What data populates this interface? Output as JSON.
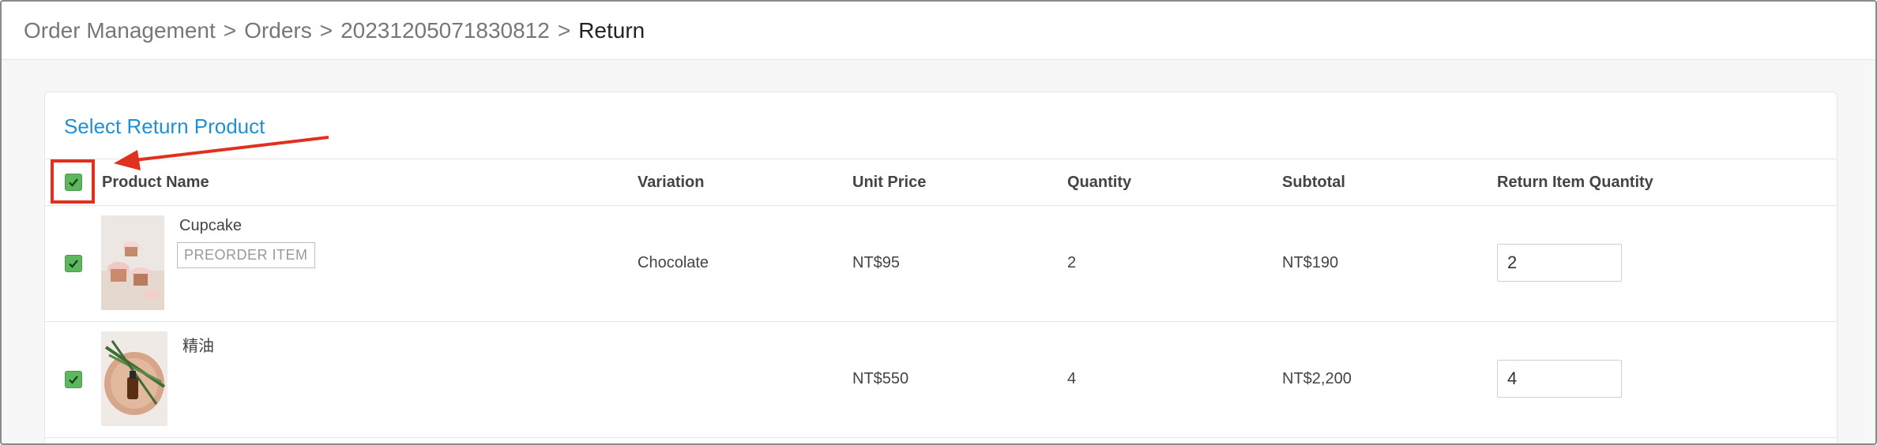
{
  "breadcrumb": {
    "items": [
      "Order Management",
      "Orders",
      "20231205071830812"
    ],
    "separator": ">",
    "current": "Return"
  },
  "section": {
    "title": "Select Return Product"
  },
  "table": {
    "select_all_checked": true,
    "headers": {
      "product_name": "Product Name",
      "variation": "Variation",
      "unit_price": "Unit Price",
      "quantity": "Quantity",
      "subtotal": "Subtotal",
      "return_qty": "Return Item Quantity"
    },
    "rows": [
      {
        "checked": true,
        "name": "Cupcake",
        "tag": "PREORDER ITEM",
        "variation": "Chocolate",
        "unit_price": "NT$95",
        "quantity": "2",
        "subtotal": "NT$190",
        "return_qty": "2"
      },
      {
        "checked": true,
        "name": "精油",
        "tag": "",
        "variation": "",
        "unit_price": "NT$550",
        "quantity": "4",
        "subtotal": "NT$2,200",
        "return_qty": "4"
      }
    ]
  },
  "colors": {
    "accent": "#1f8fd8",
    "checkbox": "#5cb85c",
    "annotation": "#e0301e"
  }
}
